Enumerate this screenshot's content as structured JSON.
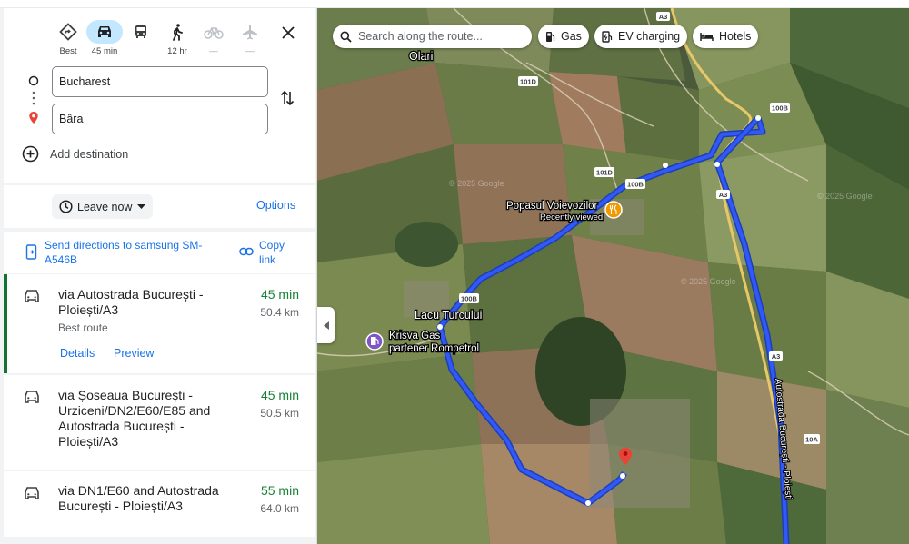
{
  "modes": [
    {
      "name": "best",
      "label": "Best",
      "icon": "diamond-directions-icon"
    },
    {
      "name": "driving",
      "label": "45 min",
      "icon": "car-icon"
    },
    {
      "name": "transit",
      "label": "",
      "icon": "bus-icon"
    },
    {
      "name": "walking",
      "label": "12 hr",
      "icon": "walking-icon"
    },
    {
      "name": "cycling",
      "label": "—",
      "icon": "bicycle-icon"
    },
    {
      "name": "flights",
      "label": "—",
      "icon": "airplane-icon"
    }
  ],
  "origin": "Bucharest",
  "destination": "Bâra",
  "add_destination": "Add destination",
  "leave_now": "Leave now",
  "options": "Options",
  "send_directions": "Send directions to samsung SM-A546B",
  "copy_link": "Copy link",
  "routes": [
    {
      "title": "via Autostrada București - Ploiești/A3",
      "time": "45 min",
      "distance": "50.4 km",
      "tag": "Best route",
      "details": "Details",
      "preview": "Preview"
    },
    {
      "title": "via Șoseaua București - Urziceni/DN2/E60/E85 and Autostrada București - Ploiești/A3",
      "time": "45 min",
      "distance": "50.5 km"
    },
    {
      "title": "via DN1/E60 and Autostrada București - Ploiești/A3",
      "time": "55 min",
      "distance": "64.0 km"
    }
  ],
  "map": {
    "search_placeholder": "Search along the route...",
    "chips": [
      "Gas",
      "EV charging",
      "Hotels"
    ],
    "places": {
      "olari": "Olari",
      "popasul": "Popasul Voievozilor",
      "recently_viewed": "Recently viewed",
      "lacu": "Lacu Turcului",
      "krisva1": "Krisva Gas",
      "krisva2": "partener Rompetrol"
    },
    "road_labels": [
      "A3",
      "101D",
      "101D",
      "100B",
      "100B",
      "A3",
      "100B",
      "A3",
      "10A"
    ],
    "watermark": "© 2025 Google",
    "highway_label": "Autostrada București - Ploiești",
    "route_color": "#3259f5"
  }
}
